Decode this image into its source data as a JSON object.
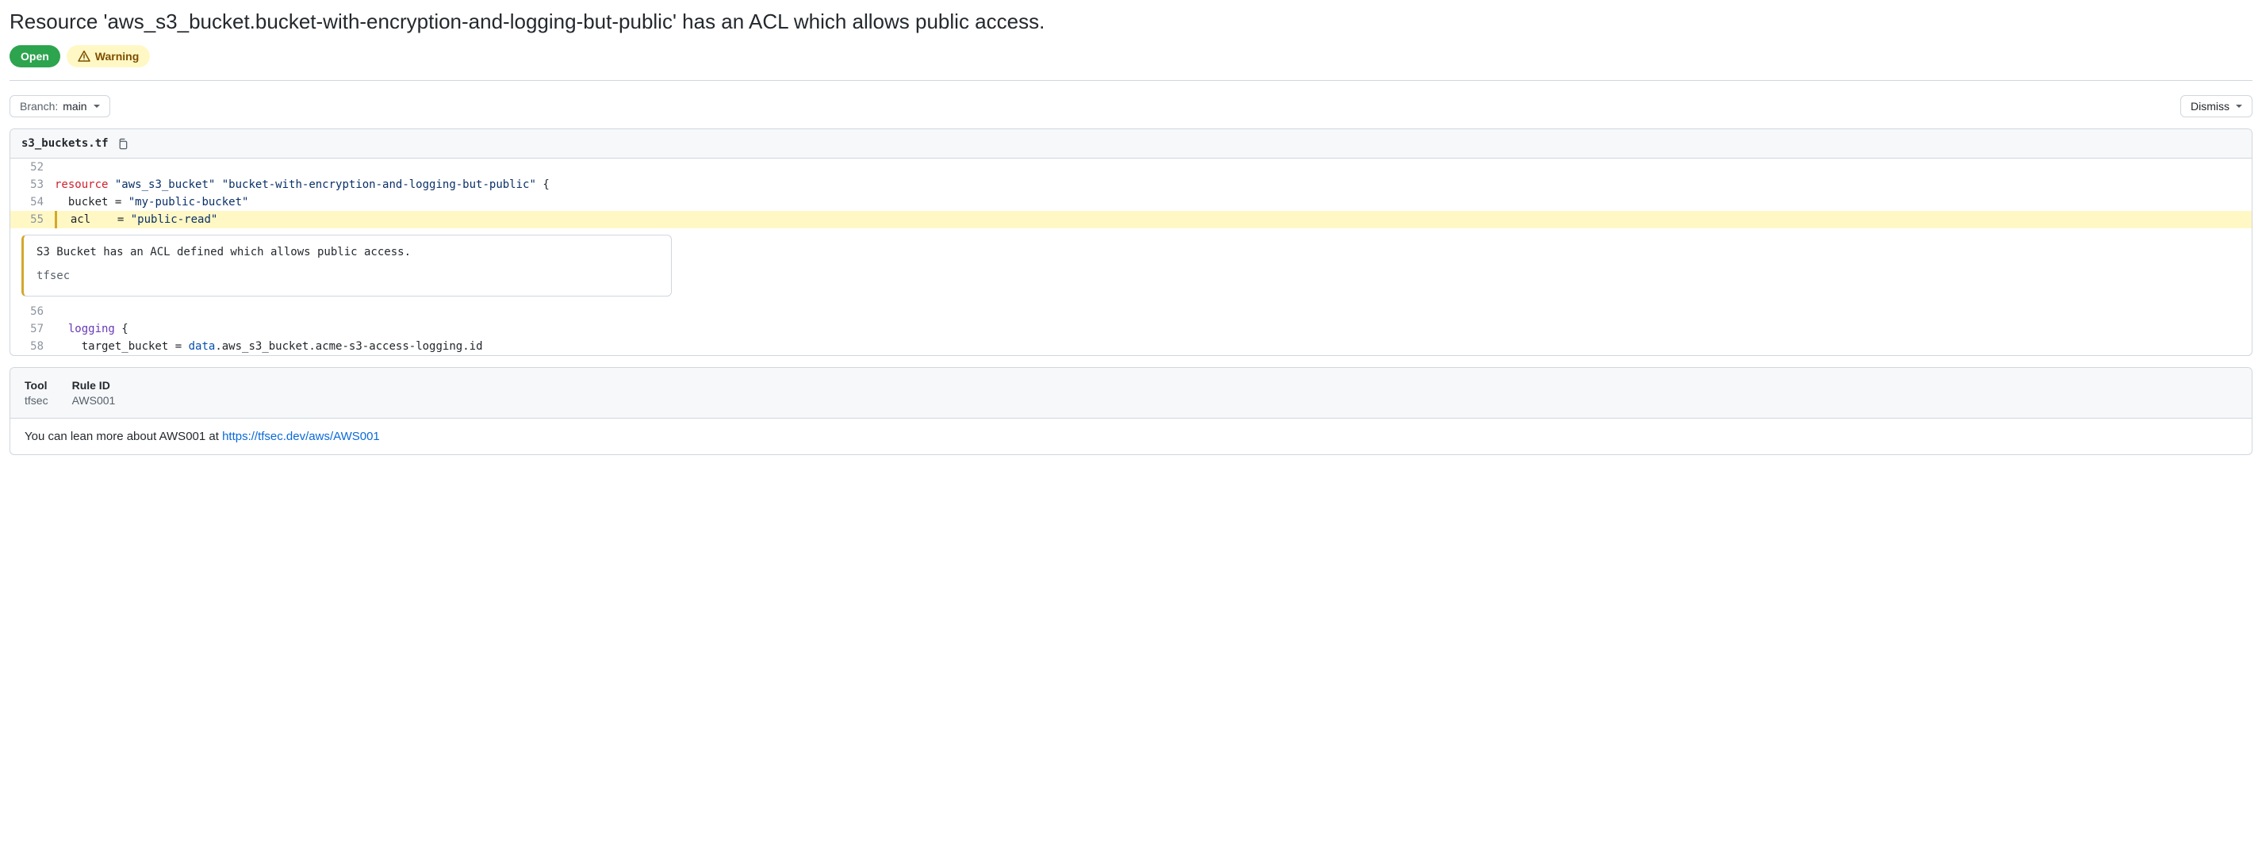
{
  "title": "Resource 'aws_s3_bucket.bucket-with-encryption-and-logging-but-public' has an ACL which allows public access.",
  "badges": {
    "open": "Open",
    "warning": "Warning"
  },
  "toolbar": {
    "branch_label": "Branch:",
    "branch_value": "main",
    "dismiss_label": "Dismiss"
  },
  "file": {
    "name": "s3_buckets.tf"
  },
  "code": {
    "lines": [
      {
        "n": "52",
        "type": "blank"
      },
      {
        "n": "53",
        "type": "resource",
        "kw": "resource",
        "s1": "\"aws_s3_bucket\"",
        "s2": "\"bucket-with-encryption-and-logging-but-public\"",
        "brace": "{"
      },
      {
        "n": "54",
        "type": "assign",
        "indent": "  ",
        "key": "bucket",
        "eq": " = ",
        "val": "\"my-public-bucket\""
      },
      {
        "n": "55",
        "type": "assign_hl",
        "indent": "  ",
        "key": "acl",
        "eq": "    = ",
        "val": "\"public-read\""
      },
      {
        "n": "56",
        "type": "blank"
      },
      {
        "n": "57",
        "type": "block",
        "indent": "  ",
        "name": "logging",
        "brace": " {"
      },
      {
        "n": "58",
        "type": "assign_data",
        "indent": "    ",
        "key": "target_bucket",
        "eq": " = ",
        "d1": "data",
        "dot1": ".",
        "d2": "aws_s3_bucket",
        "dot2": ".",
        "d3": "acme-s3-access-logging",
        "dot3": ".",
        "d4": "id"
      }
    ]
  },
  "alert": {
    "message": "S3 Bucket has an ACL defined which allows public access.",
    "tool": "tfsec"
  },
  "meta": {
    "tool_label": "Tool",
    "tool_value": "tfsec",
    "rule_label": "Rule ID",
    "rule_value": "AWS001",
    "learn_prefix": "You can lean more about AWS001 at ",
    "learn_link": "https://tfsec.dev/aws/AWS001"
  }
}
